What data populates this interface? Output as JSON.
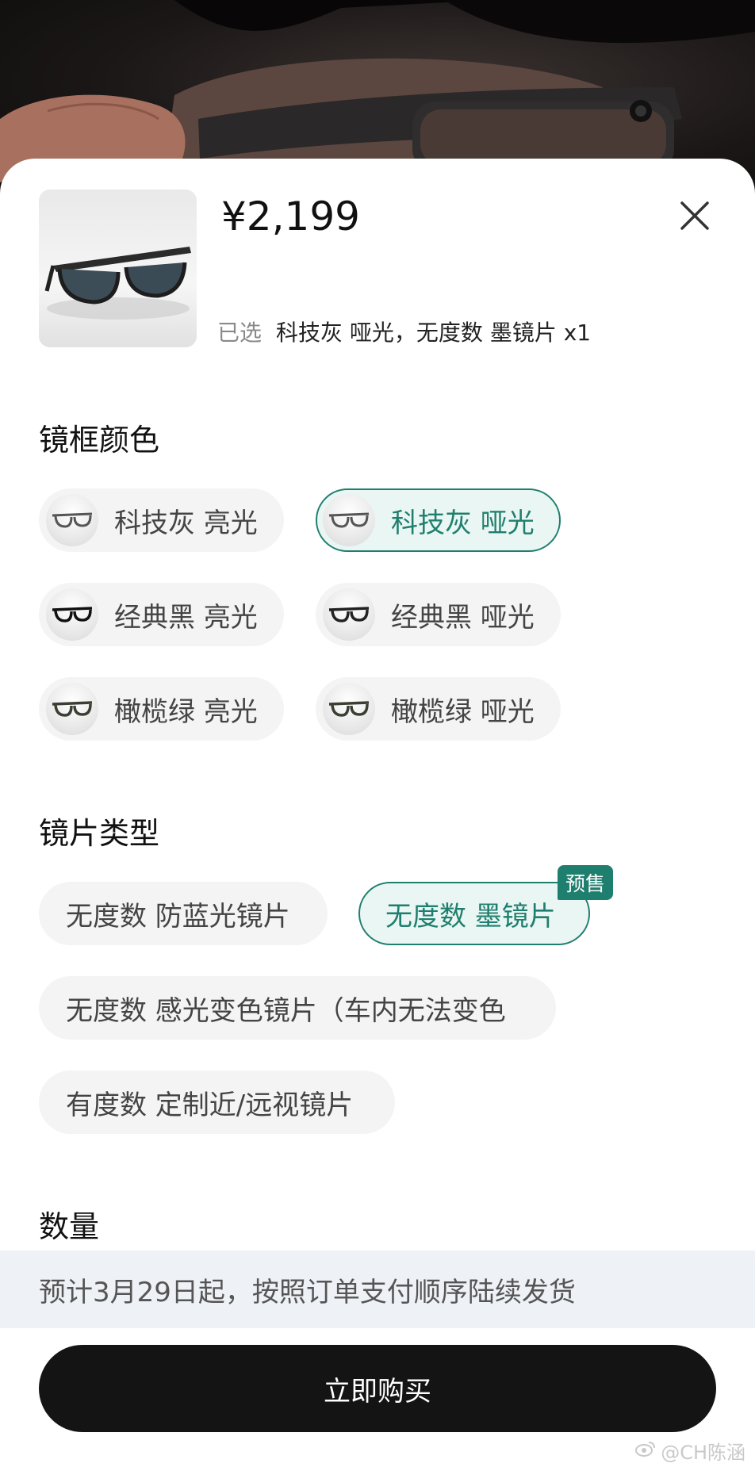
{
  "product": {
    "price": "¥2,199",
    "selected_label": "已选",
    "selected_value": "科技灰 哑光，无度数 墨镜片 x1"
  },
  "frame_color": {
    "title": "镜框颜色",
    "options": [
      {
        "label": "科技灰 亮光",
        "selected": false
      },
      {
        "label": "科技灰 哑光",
        "selected": true
      },
      {
        "label": "经典黑 亮光",
        "selected": false
      },
      {
        "label": "经典黑 哑光",
        "selected": false
      },
      {
        "label": "橄榄绿 亮光",
        "selected": false
      },
      {
        "label": "橄榄绿 哑光",
        "selected": false
      }
    ]
  },
  "lens_type": {
    "title": "镜片类型",
    "options": [
      {
        "label": "无度数 防蓝光镜片",
        "selected": false
      },
      {
        "label": "无度数 墨镜片",
        "selected": true,
        "badge": "预售"
      },
      {
        "label": "无度数 感光变色镜片（车内无法变色",
        "selected": false
      },
      {
        "label": "有度数 定制近/远视镜片",
        "selected": false
      }
    ]
  },
  "quantity": {
    "title": "数量"
  },
  "notice": "预计3月29日起，按照订单支付顺序陆续发货",
  "buy_button": "立即购买",
  "watermark": "@CH陈涵",
  "colors": {
    "accent": "#1f7f6e",
    "accent_bg": "#eaf6f3",
    "chip_bg": "#f4f4f4",
    "button_bg": "#141414",
    "notice_bg": "#eef1f5"
  },
  "icons": {
    "close": "close-icon",
    "weibo": "weibo-icon"
  }
}
